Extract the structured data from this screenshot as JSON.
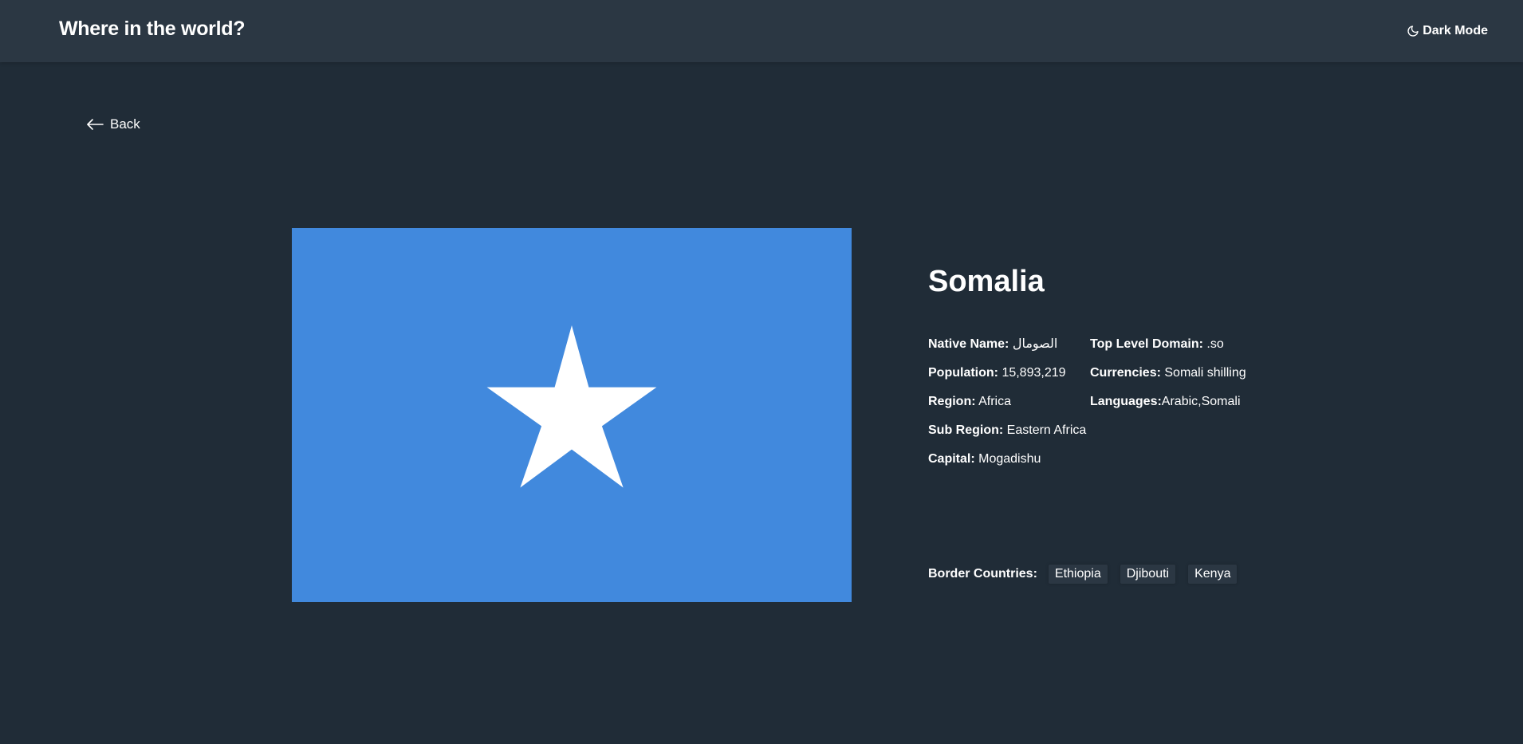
{
  "header": {
    "title": "Where in the world?",
    "theme_toggle_label": "Dark Mode",
    "theme_icon": "moon-icon"
  },
  "back": {
    "label": "Back",
    "icon": "arrow-left-icon"
  },
  "flag": {
    "field_color": "#4189dd",
    "star_color": "#ffffff"
  },
  "country": {
    "name": "Somalia",
    "native_name": {
      "label": "Native Name:",
      "value": "الصومال"
    },
    "population": {
      "label": "Population:",
      "value": "15,893,219"
    },
    "region": {
      "label": "Region:",
      "value": "Africa"
    },
    "sub_region": {
      "label": "Sub Region:",
      "value": "Eastern Africa"
    },
    "capital": {
      "label": "Capital:",
      "value": "Mogadishu"
    },
    "top_level_domain": {
      "label": "Top Level Domain:",
      "value": ".so"
    },
    "currencies": {
      "label": "Currencies:",
      "value": "Somali shilling"
    },
    "languages": {
      "label": "Languages:",
      "value": "Arabic,Somali"
    },
    "borders_label": "Border Countries:",
    "borders": [
      "Ethiopia",
      "Djibouti",
      "Kenya"
    ]
  },
  "colors": {
    "background": "#202c37",
    "elements": "#2b3743",
    "text": "#ffffff"
  }
}
